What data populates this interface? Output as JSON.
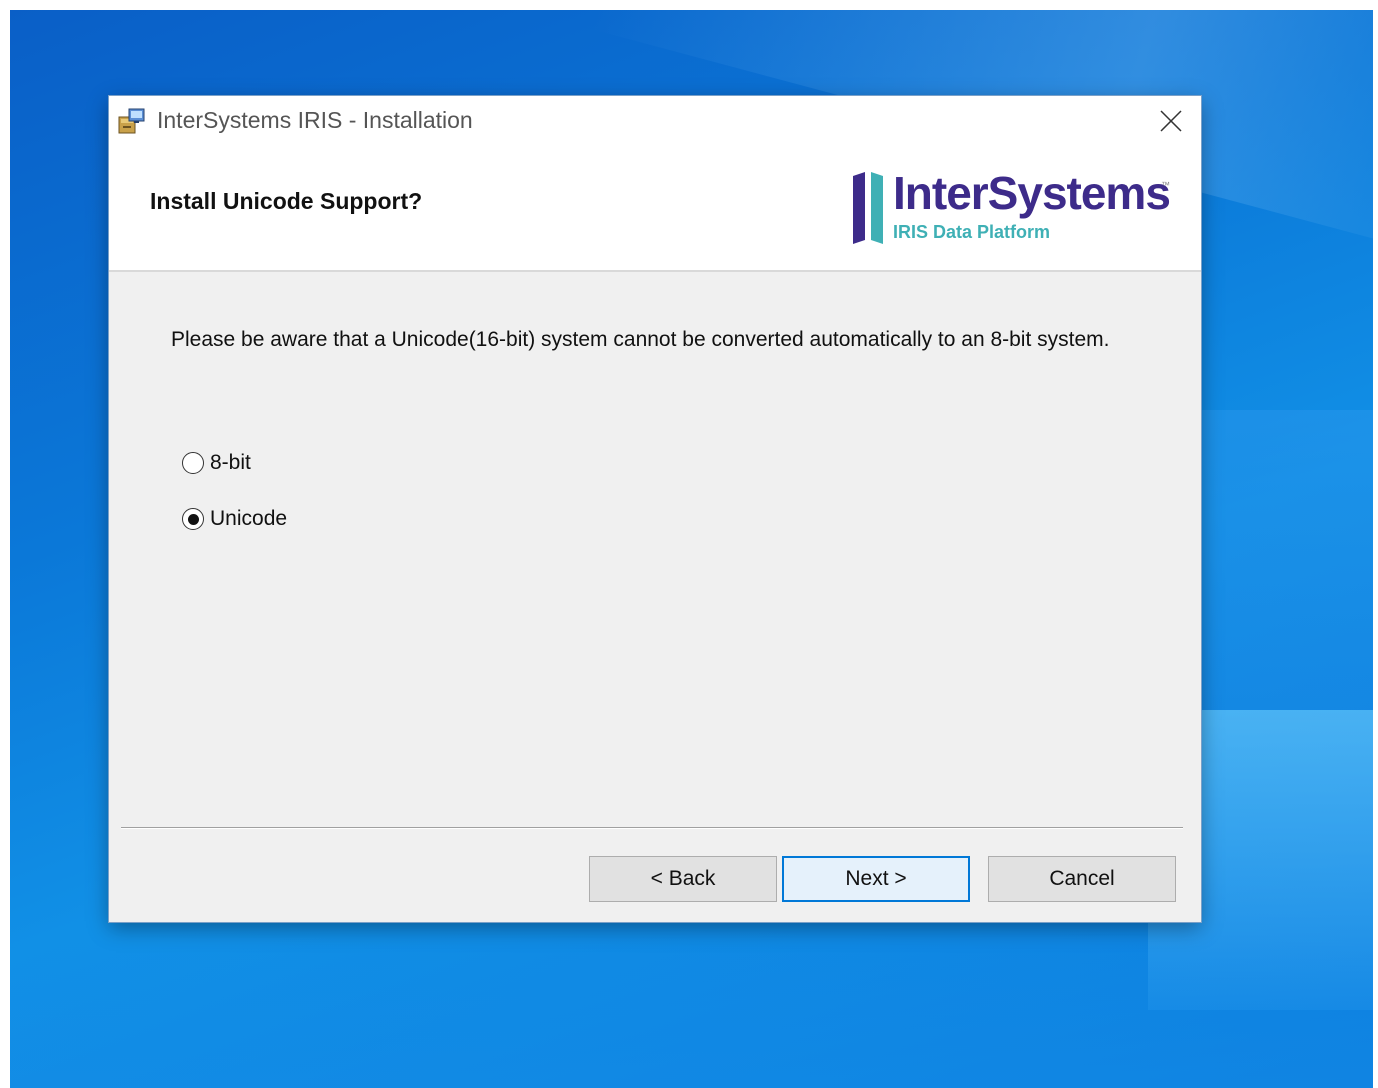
{
  "window": {
    "title": "InterSystems IRIS - Installation"
  },
  "header": {
    "title": "Install Unicode Support?",
    "logo": {
      "name": "InterSystems",
      "tagline": "IRIS Data Platform",
      "tm": "™"
    }
  },
  "body": {
    "message": "Please be aware that a Unicode(16-bit) system cannot be converted automatically to an 8-bit system.",
    "options": [
      {
        "label": "8-bit",
        "selected": false
      },
      {
        "label": "Unicode",
        "selected": true
      }
    ]
  },
  "buttons": {
    "back": "< Back",
    "next": "Next >",
    "cancel": "Cancel"
  },
  "icons": {
    "app": "installer-icon",
    "close": "close-icon"
  },
  "colors": {
    "accent": "#0078d7",
    "brand": "#3d2b8a",
    "brand_secondary": "#3fb0b5"
  }
}
